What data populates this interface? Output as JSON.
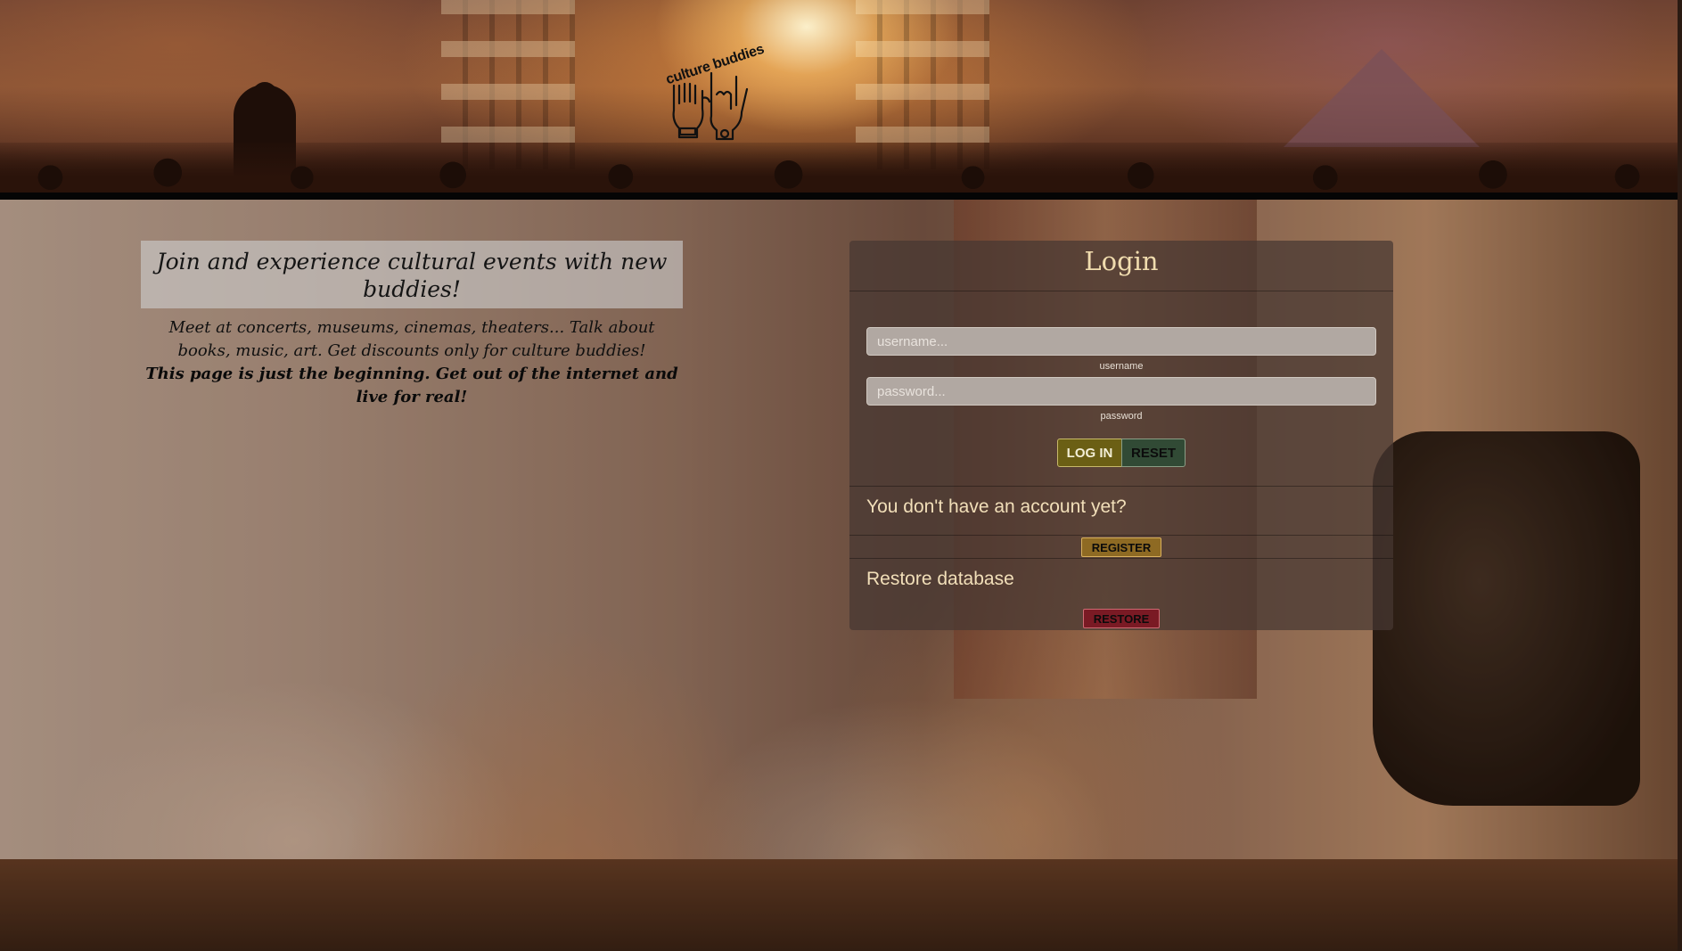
{
  "header": {
    "logo_text": "culture buddies"
  },
  "intro": {
    "title": "Join and experience cultural events with new buddies!",
    "body": "Meet at concerts, museums, cinemas, theaters... Talk about books, music, art. Get discounts only for culture buddies!",
    "highlight": "This page is just the beginning. Get out of the internet and live for real!"
  },
  "login": {
    "title": "Login",
    "username": {
      "value": "",
      "placeholder": "username...",
      "help": "username"
    },
    "password": {
      "value": "",
      "placeholder": "password...",
      "help": "password"
    },
    "login_button": "LOG IN",
    "reset_button": "RESET"
  },
  "register": {
    "heading": "You don't have an account yet?",
    "button": "REGISTER"
  },
  "restore": {
    "heading": "Restore database",
    "button": "RESTORE"
  },
  "colors": {
    "heading_text": "#f0dcae",
    "login_button": "#6b5f14",
    "reset_button": "#314a35",
    "register_button": "#8e6a23",
    "restore_button": "#7a1a24"
  }
}
